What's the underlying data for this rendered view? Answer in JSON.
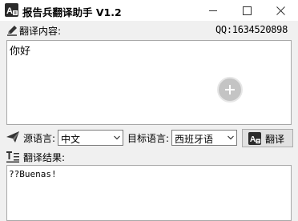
{
  "window": {
    "title": "报告兵翻译助手 V1.2",
    "icons": {
      "app": "translator-logo-icon",
      "minimize": "minimize-icon",
      "maximize": "maximize-icon",
      "close": "close-icon"
    }
  },
  "input": {
    "label": "翻译内容:",
    "label_icon": "pen-icon",
    "qq": "QQ:1634520898",
    "text": "你好",
    "add_icon": "plus-circle-icon"
  },
  "controls": {
    "source_label": "源语言:",
    "source_icon": "send-icon",
    "source_value": "中文",
    "target_label": "目标语言:",
    "target_value": "西班牙语",
    "translate_label": "翻译",
    "translate_icon": "translator-logo-icon"
  },
  "result": {
    "label": "翻译结果:",
    "label_icon": "text-format-icon",
    "text": "??Buenas!"
  },
  "colors": {
    "window_bg": "#f0f0f0",
    "titlebar_bg": "#ffffff",
    "textbox_bg": "#ffffff",
    "button_bg": "#e1e1e1",
    "logo_dark": "#2b2b2b"
  }
}
